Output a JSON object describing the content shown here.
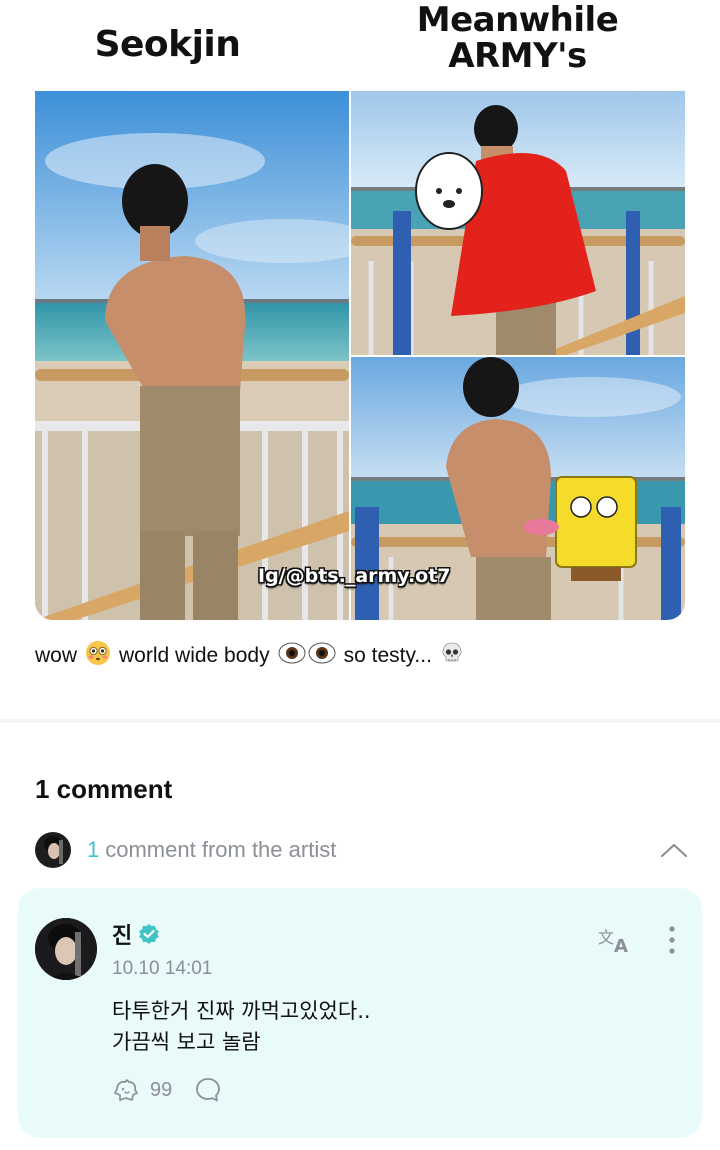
{
  "meme": {
    "label_left": "Seokjin",
    "label_right_line1": "Meanwhile",
    "label_right_line2": "ARMY's",
    "watermark": "Ig/@bts._army.ot7"
  },
  "post": {
    "caption_part1": "wow",
    "caption_part2": "world wide body",
    "caption_part3": "so testy...",
    "emoji_1": "flushed-face-icon",
    "emoji_2": "eyes-icon",
    "emoji_3": "skull-icon"
  },
  "comments": {
    "total_label": "1 comment",
    "artist_count": "1",
    "artist_label": "comment from the artist"
  },
  "artist_comment": {
    "author": "진",
    "verified": true,
    "timestamp": "10.10 14:01",
    "line1": "타투한거 진짜 까먹고있었다..",
    "line2": "가끔씩 보고 놀람",
    "like_count": "99"
  },
  "colors": {
    "accent": "#3fc3c5",
    "card_bg": "#e9fafa",
    "muted_text": "#8b8f96"
  }
}
